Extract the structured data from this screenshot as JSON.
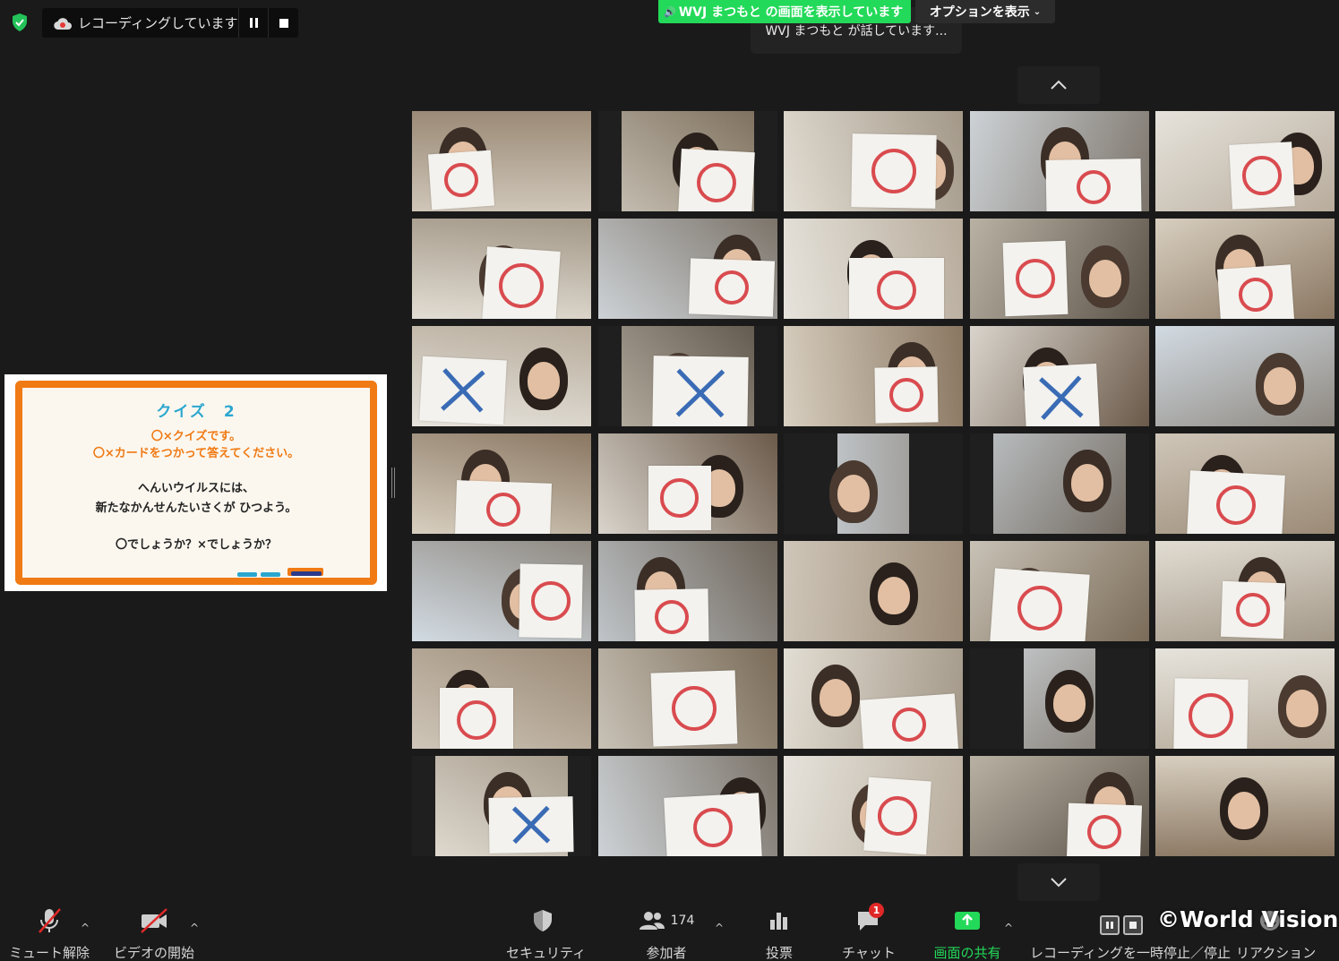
{
  "recording": {
    "status_text": "レコーディングしています...",
    "pause_label": "",
    "stop_label": ""
  },
  "top_banner": {
    "share_text": "WVJ まつもと の画面を表示しています",
    "options_label": "オプションを表示",
    "speaking_text": "WVJ まつもと が話しています..."
  },
  "slide": {
    "title": "クイズ　2",
    "line1": "〇×クイズです。",
    "line2": "〇×カードをつかって答えてください。",
    "line3": "へんいウイルスには、",
    "line4": "新たなかんせんたいさくが ひつよう。",
    "line5": "〇でしょうか？×でしょうか？"
  },
  "gallery": {
    "tiles": [
      "o",
      "o",
      "o",
      "o",
      "o",
      "o",
      "o",
      "o",
      "o",
      "o",
      "x",
      "x",
      "o",
      "x",
      "none",
      "o",
      "o",
      "none",
      "none",
      "o",
      "o",
      "o",
      "none",
      "o",
      "o",
      "o",
      "o",
      "o",
      "none",
      "o",
      "x",
      "o",
      "o",
      "o",
      "none"
    ]
  },
  "toolbar": {
    "mute_label": "ミュート解除",
    "video_label": "ビデオの開始",
    "security_label": "セキュリティ",
    "participants_label": "参加者",
    "participants_count": "174",
    "polls_label": "投票",
    "chat_label": "チャット",
    "chat_badge": "1",
    "share_label": "画面の共有",
    "pause_rec_label": "レコーディングを一時停止／停止",
    "reactions_label": "リアクション"
  },
  "watermark": "©World Vision",
  "colors": {
    "share_green": "#23d959",
    "slide_orange": "#f07a14",
    "slide_blue": "#2aa6cf",
    "mark_red": "#d94b4f",
    "mark_blue": "#3a6bb5",
    "badge_red": "#e02828"
  }
}
